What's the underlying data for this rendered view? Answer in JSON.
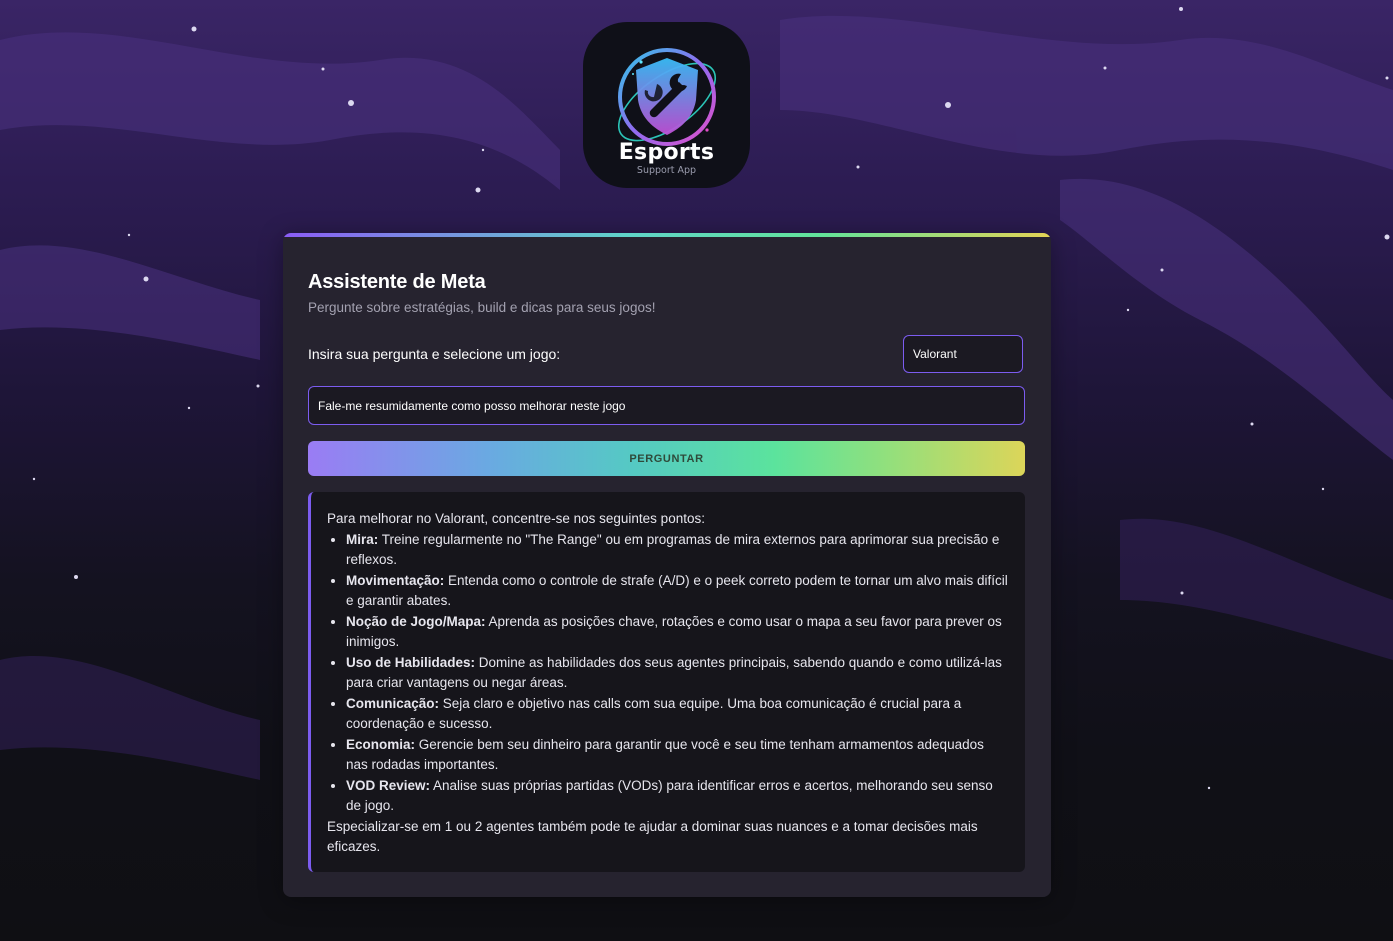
{
  "logo": {
    "title": "Esports",
    "subtitle": "Support App"
  },
  "colors": {
    "accent": "#7c5cf0",
    "card": "#26232f",
    "answer_bg": "#16151b",
    "gradient": [
      "#8b5cf6",
      "#5fd4c8",
      "#62e39a",
      "#e3d355"
    ]
  },
  "assistant": {
    "title": "Assistente de Meta",
    "subtitle": "Pergunte sobre estratégias, build e dicas para seus jogos!",
    "prompt_label": "Insira sua pergunta e selecione um jogo:",
    "selected_game": "Valorant",
    "question_value": "Fale-me resumidamente como posso melhorar neste jogo",
    "ask_button": "PERGUNTAR"
  },
  "answer": {
    "intro": "Para melhorar no Valorant, concentre-se nos seguintes pontos:",
    "items": [
      {
        "term": "Mira:",
        "text": " Treine regularmente no \"The Range\" ou em programas de mira externos para aprimorar sua precisão e reflexos."
      },
      {
        "term": "Movimentação:",
        "text": " Entenda como o controle de strafe (A/D) e o peek correto podem te tornar um alvo mais difícil e garantir abates."
      },
      {
        "term": "Noção de Jogo/Mapa:",
        "text": " Aprenda as posições chave, rotações e como usar o mapa a seu favor para prever os inimigos."
      },
      {
        "term": "Uso de Habilidades:",
        "text": " Domine as habilidades dos seus agentes principais, sabendo quando e como utilizá-las para criar vantagens ou negar áreas."
      },
      {
        "term": "Comunicação:",
        "text": " Seja claro e objetivo nas calls com sua equipe. Uma boa comunicação é crucial para a coordenação e sucesso."
      },
      {
        "term": "Economia:",
        "text": " Gerencie bem seu dinheiro para garantir que você e seu time tenham armamentos adequados nas rodadas importantes."
      },
      {
        "term": "VOD Review:",
        "text": " Analise suas próprias partidas (VODs) para identificar erros e acertos, melhorando seu senso de jogo."
      }
    ],
    "outro": "Especializar-se em 1 ou 2 agentes também pode te ajudar a dominar suas nuances e a tomar decisões mais eficazes."
  }
}
